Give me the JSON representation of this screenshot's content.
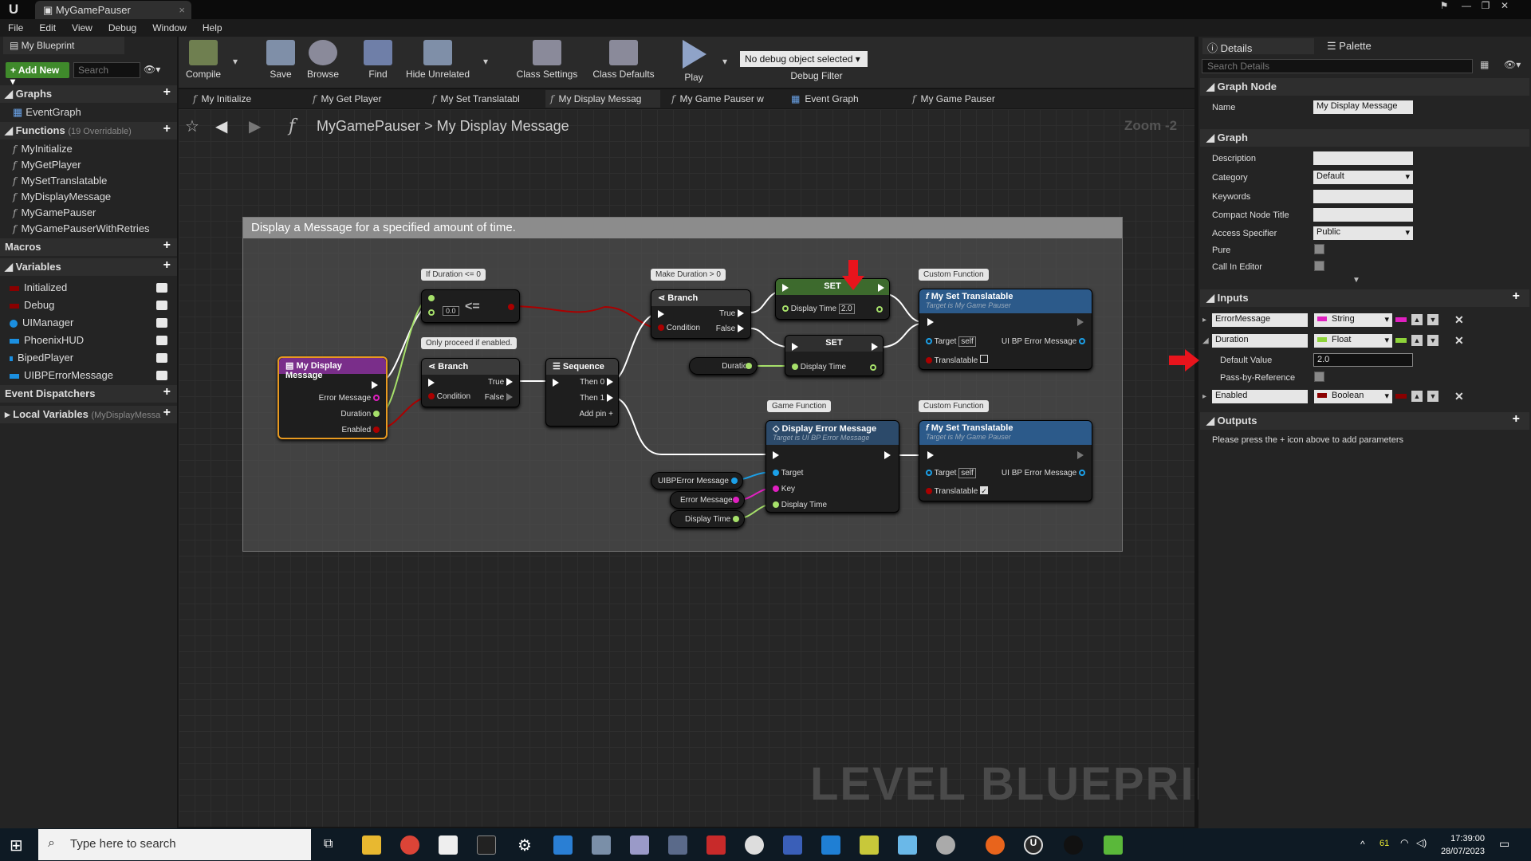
{
  "app": {
    "logo": "U",
    "document_tab": "MyGamePauser",
    "blueprint_tab": "My Blueprint"
  },
  "menu": [
    "File",
    "Edit",
    "View",
    "Debug",
    "Window",
    "Help"
  ],
  "left": {
    "add_new": "+ Add New ▾",
    "search_placeholder": "Search",
    "graphs_label": "Graphs",
    "event_graph": "EventGraph",
    "functions_label": "Functions",
    "functions_note": "(19 Overridable)",
    "functions": [
      "MyInitialize",
      "MyGetPlayer",
      "MySetTranslatable",
      "MyDisplayMessage",
      "MyGamePauser",
      "MyGamePauserWithRetries"
    ],
    "macros_label": "Macros",
    "variables_label": "Variables",
    "variables": [
      {
        "name": "Initialized",
        "color": "#8a0000"
      },
      {
        "name": "Debug",
        "color": "#8a0000"
      },
      {
        "name": "UIManager",
        "color": "#1b8fe0"
      },
      {
        "name": "PhoenixHUD",
        "color": "#1b8fe0"
      },
      {
        "name": "BipedPlayer",
        "color": "#1b8fe0"
      },
      {
        "name": "UIBPErrorMessage",
        "color": "#1b8fe0"
      }
    ],
    "dispatchers_label": "Event Dispatchers",
    "local_vars_label": "Local Variables",
    "local_vars_note": "(MyDisplayMessa"
  },
  "toolbar": {
    "compile": "Compile",
    "save": "Save",
    "browse": "Browse",
    "find": "Find",
    "hide_unrelated": "Hide Unrelated",
    "class_settings": "Class Settings",
    "class_defaults": "Class Defaults",
    "play": "Play",
    "debug_select": "No debug object selected ▾",
    "debug_filter": "Debug Filter"
  },
  "function_tabs": [
    "My Initialize",
    "My Get Player",
    "My Set Translatabl",
    "My Display Messag",
    "My Game Pauser w",
    "Event Graph",
    "My Game Pauser"
  ],
  "graph": {
    "breadcrumb_root": "MyGamePauser",
    "breadcrumb_sep": ">",
    "breadcrumb_current": "My Display Message",
    "zoom": "Zoom -2",
    "comment": "Display a Message for a specified amount of time.",
    "watermark": "LEVEL BLUEPRINT",
    "bubbles": {
      "if_duration": "If Duration <= 0",
      "only_proceed": "Only proceed if enabled.",
      "make_duration": "Make Duration > 0",
      "custom_fn_1": "Custom Function",
      "game_fn": "Game Function",
      "custom_fn_2": "Custom Function"
    },
    "nodes": {
      "entry": {
        "title": "My Display Message",
        "pins": [
          "Error Message",
          "Duration",
          "Enabled"
        ]
      },
      "compare": {
        "op": "<=",
        "val": "0.0"
      },
      "branch1": {
        "title": "Branch",
        "cond": "Condition",
        "t": "True",
        "f": "False"
      },
      "sequence": {
        "title": "Sequence",
        "p0": "Then 0",
        "p1": "Then 1",
        "add": "Add pin"
      },
      "branch2": {
        "title": "Branch",
        "cond": "Condition",
        "t": "True",
        "f": "False"
      },
      "set1": {
        "title": "SET",
        "label": "Display Time",
        "val": "2.0"
      },
      "set2": {
        "title": "SET",
        "label": "Display Time"
      },
      "duration_var": "Duration",
      "settrans1": {
        "title": "My Set Translatable",
        "sub": "Target is My Game Pauser",
        "target": "Target",
        "self": "self",
        "ui": "UI BP Error Message",
        "trans": "Translatable"
      },
      "display_err": {
        "title": "Display Error Message",
        "sub": "Target is UI BP Error Message",
        "target": "Target",
        "key": "Key",
        "time": "Display Time"
      },
      "settrans2": {
        "title": "My Set Translatable",
        "sub": "Target is My Game Pauser",
        "target": "Target",
        "self": "self",
        "ui": "UI BP Error Message",
        "trans": "Translatable"
      },
      "var_ui": "UIBPError Message",
      "var_err": "Error Message",
      "var_time": "Display Time"
    }
  },
  "right": {
    "details_tab": "Details",
    "palette_tab": "Palette",
    "search_placeholder": "Search Details",
    "graph_node": "Graph Node",
    "name_label": "Name",
    "name_value": "My Display Message",
    "graph_label": "Graph",
    "description": "Description",
    "category": "Category",
    "category_value": "Default",
    "keywords": "Keywords",
    "compact_title": "Compact Node Title",
    "access": "Access Specifier",
    "access_value": "Public",
    "pure": "Pure",
    "call_in_editor": "Call In Editor",
    "inputs_label": "Inputs",
    "inputs": [
      {
        "name": "ErrorMessage",
        "type": "String",
        "color": "#e020c0"
      },
      {
        "name": "Duration",
        "type": "Float",
        "color": "#8ed43a"
      },
      {
        "name": "Enabled",
        "type": "Boolean",
        "color": "#8a0000"
      }
    ],
    "default_value_label": "Default Value",
    "default_value": "2.0",
    "pass_by_ref": "Pass-by-Reference",
    "outputs_label": "Outputs",
    "outputs_hint": "Please press the + icon above to add parameters"
  },
  "taskbar": {
    "search_placeholder": "Type here to search",
    "tray_num": "61",
    "time": "17:39:00",
    "date": "28/07/2023"
  }
}
